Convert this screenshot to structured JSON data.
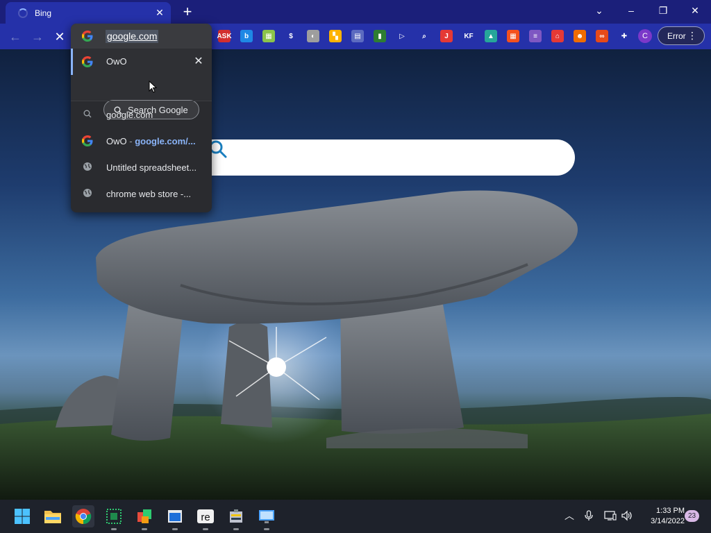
{
  "tab": {
    "title": "Bing",
    "close_label": "✕",
    "new_tab_label": "+"
  },
  "window_controls": {
    "dropdown": "⌄",
    "minimize": "–",
    "restore": "❐",
    "close": "✕"
  },
  "toolbar": {
    "back_icon": "←",
    "forward_icon": "→",
    "stop_icon": "✕",
    "extensions": [
      {
        "name": "ask-ext-icon",
        "label": "ASK",
        "color": "#d32f2f"
      },
      {
        "name": "bing-ext-icon",
        "label": "b",
        "color": "#1e88e5"
      },
      {
        "name": "grid-ext-icon",
        "label": "▦",
        "color": "#8bc34a"
      },
      {
        "name": "dollar-ext-icon",
        "label": "$",
        "color": "#2531a9"
      },
      {
        "name": "moon-ext-icon",
        "label": "◐",
        "color": "#9e9e9e"
      },
      {
        "name": "puzzle-ext-icon",
        "label": "▚",
        "color": "#ffb300"
      },
      {
        "name": "doc-ext-icon",
        "label": "▤",
        "color": "#5c6bc0"
      },
      {
        "name": "leaf-ext-icon",
        "label": "▮",
        "color": "#2e7d32"
      },
      {
        "name": "play-ext-icon",
        "label": "▷",
        "color": "#2531a9"
      },
      {
        "name": "magnifier-ext-icon",
        "label": "⌕",
        "color": "#2531a9"
      },
      {
        "name": "j-ext-icon",
        "label": "J",
        "color": "#e53935"
      },
      {
        "name": "kf-ext-icon",
        "label": "KF",
        "color": "#2531a9"
      },
      {
        "name": "image-ext-icon",
        "label": "▲",
        "color": "#26a69a"
      },
      {
        "name": "windows-ext-icon",
        "label": "▦",
        "color": "#f4511e"
      },
      {
        "name": "bars-ext-icon",
        "label": "≡",
        "color": "#7e57c2"
      },
      {
        "name": "home-ext-icon",
        "label": "⌂",
        "color": "#e53935"
      },
      {
        "name": "face-ext-icon",
        "label": "☻",
        "color": "#ef6c00"
      },
      {
        "name": "infinity-ext-icon",
        "label": "∞",
        "color": "#e64a19"
      },
      {
        "name": "extensions-puzzle-icon",
        "label": "✚",
        "color": "#2531a9"
      }
    ],
    "profile_initial": "C",
    "error_label": "Error",
    "menu_dots": "⋮"
  },
  "omnibox": {
    "input_value": "google.com",
    "rows": [
      {
        "text": "OwO"
      },
      {
        "text": "google.com"
      },
      {
        "text": "OwO",
        "sep": " - ",
        "url": "google.com/..."
      },
      {
        "text": "Untitled spreadsheet..."
      },
      {
        "text": "chrome web store -..."
      }
    ],
    "search_google_label": "Search Google",
    "remove_label": "✕"
  },
  "taskbar": {
    "clock_time": "1:33 PM",
    "clock_date": "3/14/2022",
    "notification_count": "23",
    "tray": {
      "chevron": "︿",
      "mic": "🎙",
      "network": "🖥",
      "volume": "🔊"
    }
  }
}
